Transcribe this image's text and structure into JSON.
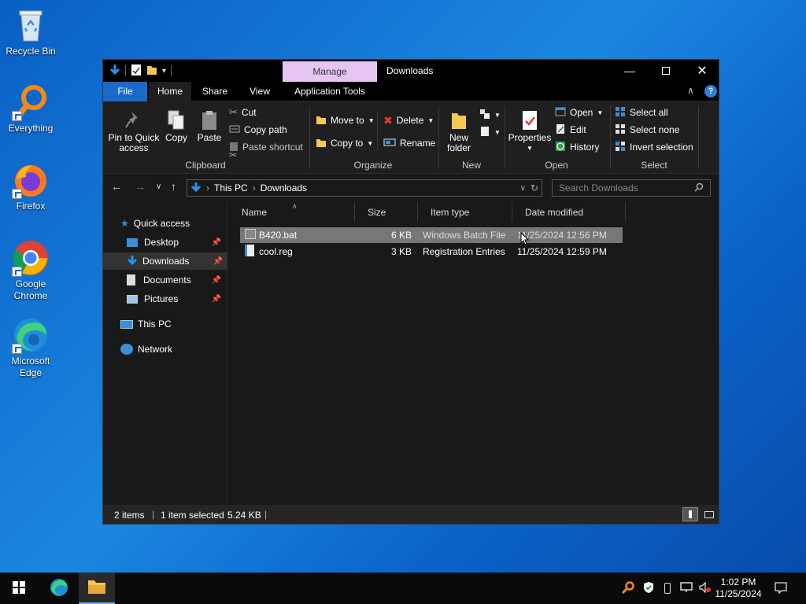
{
  "desktop": {
    "icons": [
      {
        "label": "Recycle Bin"
      },
      {
        "label": "Everything"
      },
      {
        "label": "Firefox"
      },
      {
        "label": "Google Chrome"
      },
      {
        "label": "Microsoft Edge"
      }
    ]
  },
  "window": {
    "title": "Downloads",
    "context_tab": "Manage",
    "tabs": [
      "File",
      "Home",
      "Share",
      "View",
      "Application Tools"
    ],
    "ribbon": {
      "clipboard": {
        "label": "Clipboard",
        "pin": "Pin to Quick access",
        "copy": "Copy",
        "paste": "Paste",
        "cut": "Cut",
        "copy_path": "Copy path",
        "paste_shortcut": "Paste shortcut"
      },
      "organize": {
        "label": "Organize",
        "move_to": "Move to",
        "copy_to": "Copy to",
        "delete": "Delete",
        "rename": "Rename"
      },
      "new": {
        "label": "New",
        "new_folder": "New folder"
      },
      "open": {
        "label": "Open",
        "properties": "Properties",
        "open": "Open",
        "edit": "Edit",
        "history": "History"
      },
      "select": {
        "label": "Select",
        "select_all": "Select all",
        "select_none": "Select none",
        "invert": "Invert selection"
      }
    },
    "address": {
      "crumbs": [
        "This PC",
        "Downloads"
      ],
      "search_placeholder": "Search Downloads"
    },
    "nav": {
      "quick_access": "Quick access",
      "items": [
        {
          "label": "Desktop"
        },
        {
          "label": "Downloads"
        },
        {
          "label": "Documents"
        },
        {
          "label": "Pictures"
        }
      ],
      "this_pc": "This PC",
      "network": "Network"
    },
    "columns": [
      "Name",
      "Size",
      "Item type",
      "Date modified"
    ],
    "files": [
      {
        "name": "B420.bat",
        "size": "6 KB",
        "type": "Windows Batch File",
        "date": "11/25/2024 12:56 PM"
      },
      {
        "name": "cool.reg",
        "size": "3 KB",
        "type": "Registration Entries",
        "date": "11/25/2024 12:59 PM"
      }
    ],
    "status": {
      "count": "2 items",
      "selected": "1 item selected",
      "size": "5.24 KB"
    }
  },
  "taskbar": {
    "time": "1:02 PM",
    "date": "11/25/2024"
  },
  "colors": {
    "file_tab": "#1b6ac9",
    "context_tab": "#e7c5f3",
    "selection": "#777777"
  }
}
